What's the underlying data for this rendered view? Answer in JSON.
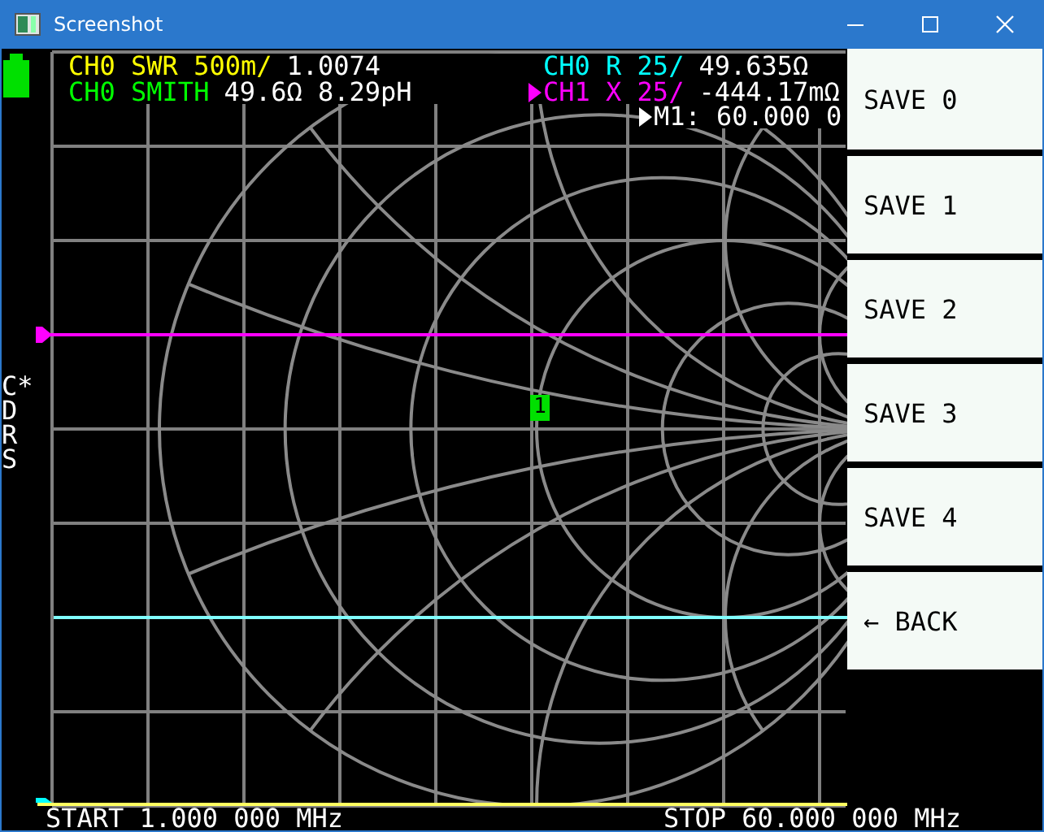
{
  "window": {
    "title": "Screenshot"
  },
  "traces": [
    {
      "label": "CH0 SWR 500m/",
      "value": "1.0074",
      "color": "#ffff00",
      "active": false
    },
    {
      "label": "CH0 R 25/",
      "value": "49.635Ω",
      "color": "#00ffff",
      "active": false
    },
    {
      "label": "CH0 SMITH",
      "value": "49.6Ω 8.29pH",
      "color": "#00ff00",
      "active": false
    },
    {
      "label": "CH1 X 25/",
      "value": "-444.17mΩ",
      "color": "#ff00ff",
      "active": true
    }
  ],
  "marker": {
    "label": "1",
    "readout": "M1: 60.000 0"
  },
  "status_flags": [
    "C*",
    "D",
    "R",
    "S"
  ],
  "sweep": {
    "start": "START 1.000 000 MHz",
    "stop": "STOP 60.000 000 MHz"
  },
  "menu": [
    {
      "label": "SAVE 0"
    },
    {
      "label": "SAVE 1"
    },
    {
      "label": "SAVE 2"
    },
    {
      "label": "SAVE 3"
    },
    {
      "label": "SAVE 4"
    },
    {
      "label": "← BACK"
    }
  ]
}
